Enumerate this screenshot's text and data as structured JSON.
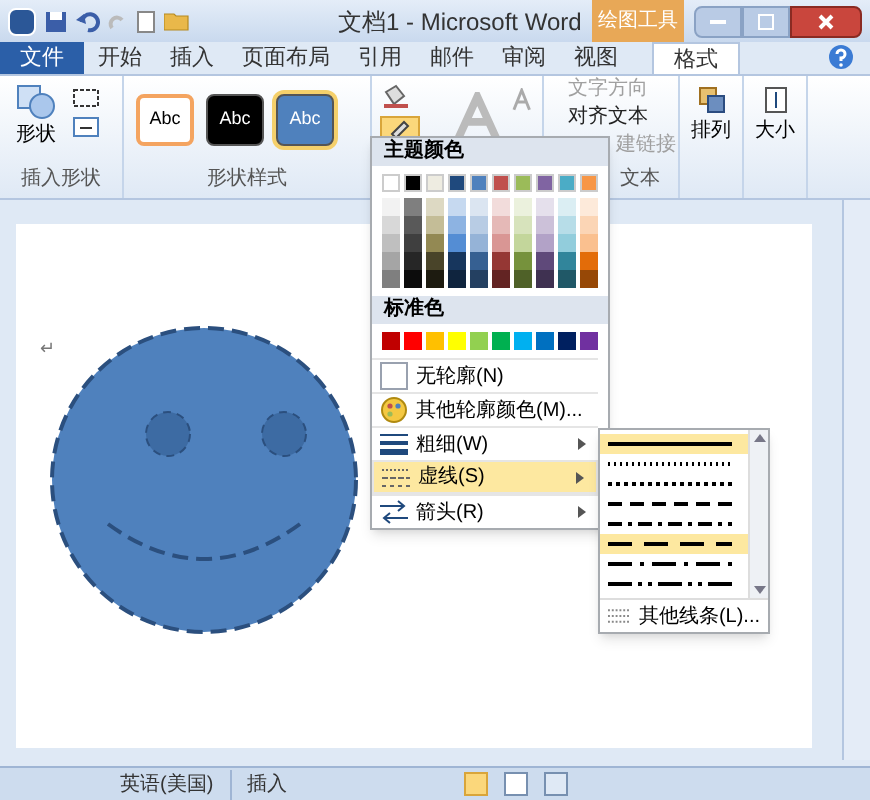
{
  "window": {
    "title": "文档1 - Microsoft Word",
    "context_tab": "绘图工具"
  },
  "tabs": [
    {
      "label": "文件",
      "kind": "file",
      "selected": false
    },
    {
      "label": "开始",
      "kind": "tab",
      "selected": false
    },
    {
      "label": "插入",
      "kind": "tab",
      "selected": false
    },
    {
      "label": "页面布局",
      "kind": "tab",
      "selected": false
    },
    {
      "label": "引用",
      "kind": "tab",
      "selected": false
    },
    {
      "label": "邮件",
      "kind": "tab",
      "selected": false
    },
    {
      "label": "审阅",
      "kind": "tab",
      "selected": false
    },
    {
      "label": "视图",
      "kind": "tab",
      "selected": false
    },
    {
      "label": "格式",
      "kind": "tab",
      "selected": true
    }
  ],
  "ribbon": {
    "insert_shapes": {
      "big_button": "形状",
      "label": "插入形状"
    },
    "shape_styles": {
      "label": "形状样式",
      "styles": [
        {
          "text": "Abc",
          "kind": "outline",
          "color": "#f4a460",
          "selected": false
        },
        {
          "text": "Abc",
          "kind": "filled",
          "color": "#000000",
          "selected": false
        },
        {
          "text": "Abc",
          "kind": "filled",
          "color": "#4f81bd",
          "selected": true
        }
      ]
    },
    "text_group": {
      "items": [
        {
          "label": "文字方向",
          "disabled": true
        },
        {
          "label": "对齐文本",
          "disabled": false
        },
        {
          "label": "建链接",
          "disabled": true
        }
      ],
      "label": "文本"
    },
    "arrange": {
      "label": "排列"
    },
    "size": {
      "label": "大小"
    }
  },
  "outline_menu": {
    "theme_header": "主题颜色",
    "theme_colors": [
      {
        "color": "#ffffff",
        "shades": [
          {
            "color": "#f2f2f2"
          },
          {
            "color": "#d8d8d8"
          },
          {
            "color": "#bfbfbf"
          },
          {
            "color": "#a5a5a5"
          },
          {
            "color": "#7f7f7f"
          }
        ]
      },
      {
        "color": "#000000",
        "shades": [
          {
            "color": "#7f7f7f"
          },
          {
            "color": "#595959"
          },
          {
            "color": "#3f3f3f"
          },
          {
            "color": "#262626"
          },
          {
            "color": "#0c0c0c"
          }
        ]
      },
      {
        "color": "#eeece1",
        "shades": [
          {
            "color": "#ddd9c3"
          },
          {
            "color": "#c4bd97"
          },
          {
            "color": "#938953"
          },
          {
            "color": "#494429"
          },
          {
            "color": "#1d1b10"
          }
        ]
      },
      {
        "color": "#1f497d",
        "shades": [
          {
            "color": "#c6d9f0"
          },
          {
            "color": "#8db3e2"
          },
          {
            "color": "#548dd4"
          },
          {
            "color": "#17365d"
          },
          {
            "color": "#0f243e"
          }
        ]
      },
      {
        "color": "#4f81bd",
        "shades": [
          {
            "color": "#dbe5f1"
          },
          {
            "color": "#b8cce4"
          },
          {
            "color": "#95b3d7"
          },
          {
            "color": "#366092"
          },
          {
            "color": "#244061"
          }
        ]
      },
      {
        "color": "#c0504d",
        "shades": [
          {
            "color": "#f2dcdb"
          },
          {
            "color": "#e5b9b7"
          },
          {
            "color": "#d99694"
          },
          {
            "color": "#953734"
          },
          {
            "color": "#632423"
          }
        ]
      },
      {
        "color": "#9bbb59",
        "shades": [
          {
            "color": "#ebf1dd"
          },
          {
            "color": "#d7e3bc"
          },
          {
            "color": "#c3d69b"
          },
          {
            "color": "#76923c"
          },
          {
            "color": "#4f6128"
          }
        ]
      },
      {
        "color": "#8064a2",
        "shades": [
          {
            "color": "#e5e0ec"
          },
          {
            "color": "#ccc1d9"
          },
          {
            "color": "#b2a2c7"
          },
          {
            "color": "#5f497a"
          },
          {
            "color": "#3f3151"
          }
        ]
      },
      {
        "color": "#4bacc6",
        "shades": [
          {
            "color": "#dbeef3"
          },
          {
            "color": "#b7dde8"
          },
          {
            "color": "#92cddc"
          },
          {
            "color": "#31859b"
          },
          {
            "color": "#205867"
          }
        ]
      },
      {
        "color": "#f79646",
        "shades": [
          {
            "color": "#fdeada"
          },
          {
            "color": "#fbd5b5"
          },
          {
            "color": "#fac08f"
          },
          {
            "color": "#e36c09"
          },
          {
            "color": "#974806"
          }
        ]
      }
    ],
    "standard_header": "标准色",
    "standard_colors": [
      {
        "color": "#c00000"
      },
      {
        "color": "#ff0000"
      },
      {
        "color": "#ffc000"
      },
      {
        "color": "#ffff00"
      },
      {
        "color": "#92d050"
      },
      {
        "color": "#00b050"
      },
      {
        "color": "#00b0f0"
      },
      {
        "color": "#0070c0"
      },
      {
        "color": "#002060"
      },
      {
        "color": "#7030a0"
      }
    ],
    "items": [
      {
        "label": "无轮廓(N)",
        "kind": "none",
        "submenu": false,
        "selected": false
      },
      {
        "label": "其他轮廓颜色(M)...",
        "kind": "palette",
        "submenu": false,
        "selected": false
      },
      {
        "label": "粗细(W)",
        "kind": "weight",
        "submenu": true,
        "selected": false
      },
      {
        "label": "虚线(S)",
        "kind": "dash",
        "submenu": true,
        "selected": true
      },
      {
        "label": "箭头(R)",
        "kind": "arrows",
        "submenu": true,
        "selected": false
      }
    ]
  },
  "dash_submenu": {
    "styles": [
      {
        "kind": "solid",
        "highlighted": true
      },
      {
        "kind": "round-dot",
        "highlighted": false
      },
      {
        "kind": "square-dot",
        "highlighted": false
      },
      {
        "kind": "dash",
        "highlighted": false
      },
      {
        "kind": "dash-dot",
        "highlighted": false
      },
      {
        "kind": "long-dash",
        "highlighted": true
      },
      {
        "kind": "long-dash-dot",
        "highlighted": false
      },
      {
        "kind": "long-dash-dot-dot",
        "highlighted": false
      }
    ],
    "more": "其他线条(L)..."
  },
  "document": {
    "paragraph_mark": "↵"
  },
  "status_bar": {
    "language": "英语(美国)",
    "mode": "插入"
  }
}
